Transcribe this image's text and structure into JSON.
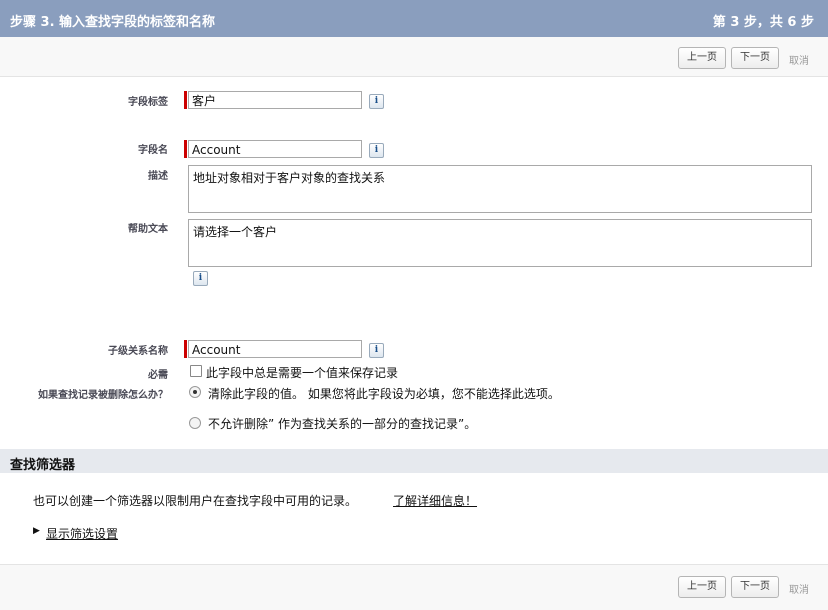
{
  "header": {
    "title": "步骤 3. 输入查找字段的标签和名称",
    "step": "第 3 步，共 6 步"
  },
  "nav": {
    "prev": "上一页",
    "next": "下一页",
    "cancel": "取消"
  },
  "fields": {
    "label_label": "字段标签",
    "label_value": "客户",
    "name_label": "字段名",
    "name_value": "Account",
    "desc_label": "描述",
    "desc_value": "地址对象相对于客户对象的查找关系",
    "help_label": "帮助文本",
    "help_value": "请选择一个客户",
    "child_label": "子级关系名称",
    "child_value": "Account",
    "required_label": "必需",
    "required_text": "此字段中总是需要一个值来保存记录",
    "delete_label": "如果查找记录被删除怎么办？",
    "delete_opt1": "清除此字段的值。 如果您将此字段设为必填，您不能选择此选项。",
    "delete_opt2": "不允许删除” 作为查找关系的一部分的查找记录”。"
  },
  "filter": {
    "title": "查找筛选器",
    "desc": "也可以创建一个筛选器以限制用户在查找字段中可用的记录。",
    "learn_more": "了解详细信息！",
    "show_settings": "显示筛选设置"
  },
  "icons": {
    "info": "i",
    "triangle": "▶"
  }
}
